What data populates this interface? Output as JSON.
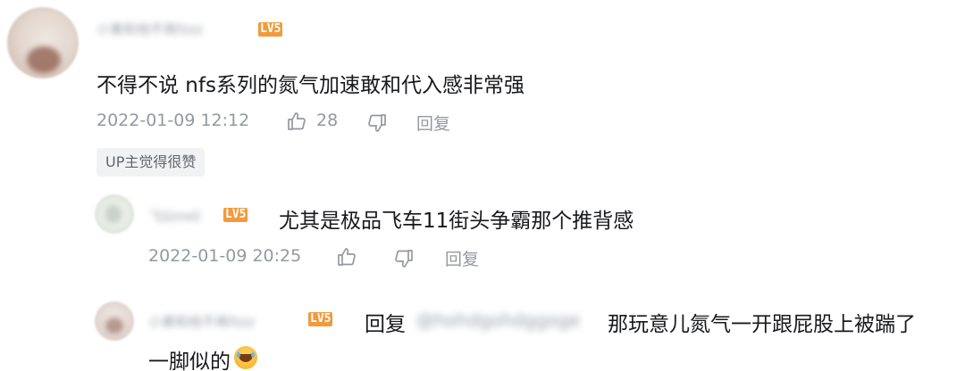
{
  "comment": {
    "username": "小黄和他不再fzzz",
    "level_badge": "LV5",
    "text": "不得不说  nfs系列的氮气加速敢和代入感非常强",
    "timestamp": "2022-01-09 12:12",
    "like_count": "28",
    "reply_label": "回复",
    "up_tag": "UP主觉得很赞"
  },
  "replies": [
    {
      "username": "飞Sirrell",
      "level_badge": "LV5",
      "text": "尤其是极品飞车11街头争霸那个推背感",
      "timestamp": "2022-01-09 20:25",
      "reply_label": "回复"
    },
    {
      "username": "小黄和他不再fzzz",
      "level_badge": "LV5",
      "reply_prefix": "回复",
      "mention": "@hohdgohdggoge",
      "text_line1": "那玩意儿氮气一开跟屁股上被踹了",
      "text_line2": "一脚似的"
    }
  ],
  "icons": {
    "like": "thumbs-up-icon",
    "dislike": "thumbs-down-icon",
    "emoji": "laughing-tears-emoji"
  },
  "colors": {
    "level_badge": "#f19a3e",
    "meta_text": "#9499a0",
    "content_text": "#18191c"
  }
}
